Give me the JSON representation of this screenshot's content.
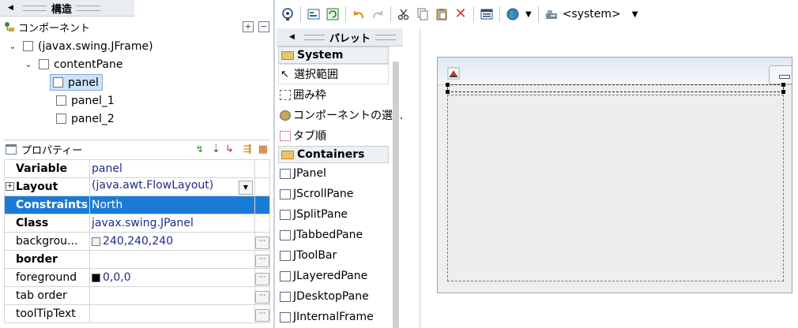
{
  "structure": {
    "title": "構造",
    "components_title": "コンポーネント",
    "tree": [
      {
        "label": "(javax.swing.JFrame)",
        "level": 0,
        "expanded": true
      },
      {
        "label": "contentPane",
        "level": 1,
        "expanded": true
      },
      {
        "label": "panel",
        "level": 2,
        "selected": true
      },
      {
        "label": "panel_1",
        "level": 2
      },
      {
        "label": "panel_2",
        "level": 2
      }
    ]
  },
  "properties": {
    "title": "プロパティー",
    "rows": [
      {
        "name": "Variable",
        "value": "panel",
        "bold": true
      },
      {
        "name": "Layout",
        "value": "(java.awt.FlowLayout)",
        "bold": true,
        "expandable": true,
        "dropdown": true
      },
      {
        "name": "Constraints",
        "value": "North",
        "bold": true,
        "selected": true
      },
      {
        "name": "Class",
        "value": "javax.swing.JPanel",
        "bold": true
      },
      {
        "name": "backgrou...",
        "value": "240,240,240",
        "swatch": "#f0f0f0",
        "button": true
      },
      {
        "name": "border",
        "value": "",
        "bold": true,
        "button": true
      },
      {
        "name": "foreground",
        "value": "0,0,0",
        "swatch": "#000000",
        "button": true
      },
      {
        "name": "tab order",
        "value": "",
        "button": true
      },
      {
        "name": "toolTipText",
        "value": "",
        "button": true
      }
    ],
    "dropdown_arrow": "▼",
    "button_label": "···"
  },
  "toolbar": {
    "look_and_feel": "<system>",
    "dropdown_arrow": "▼"
  },
  "palette": {
    "title": "パレット",
    "categories": [
      {
        "name": "System",
        "items": [
          "選択範囲",
          "囲み枠",
          "コンポーネントの選...",
          "タブ順"
        ]
      },
      {
        "name": "Containers",
        "items": [
          "JPanel",
          "JScrollPane",
          "JSplitPane",
          "JTabbedPane",
          "JToolBar",
          "JLayeredPane",
          "JDesktopPane",
          "JInternalFrame"
        ]
      }
    ]
  },
  "colors": {
    "selection": "#1a7bd6",
    "value_text": "#1f2a8f",
    "tree_selection": "#cde4f7"
  }
}
